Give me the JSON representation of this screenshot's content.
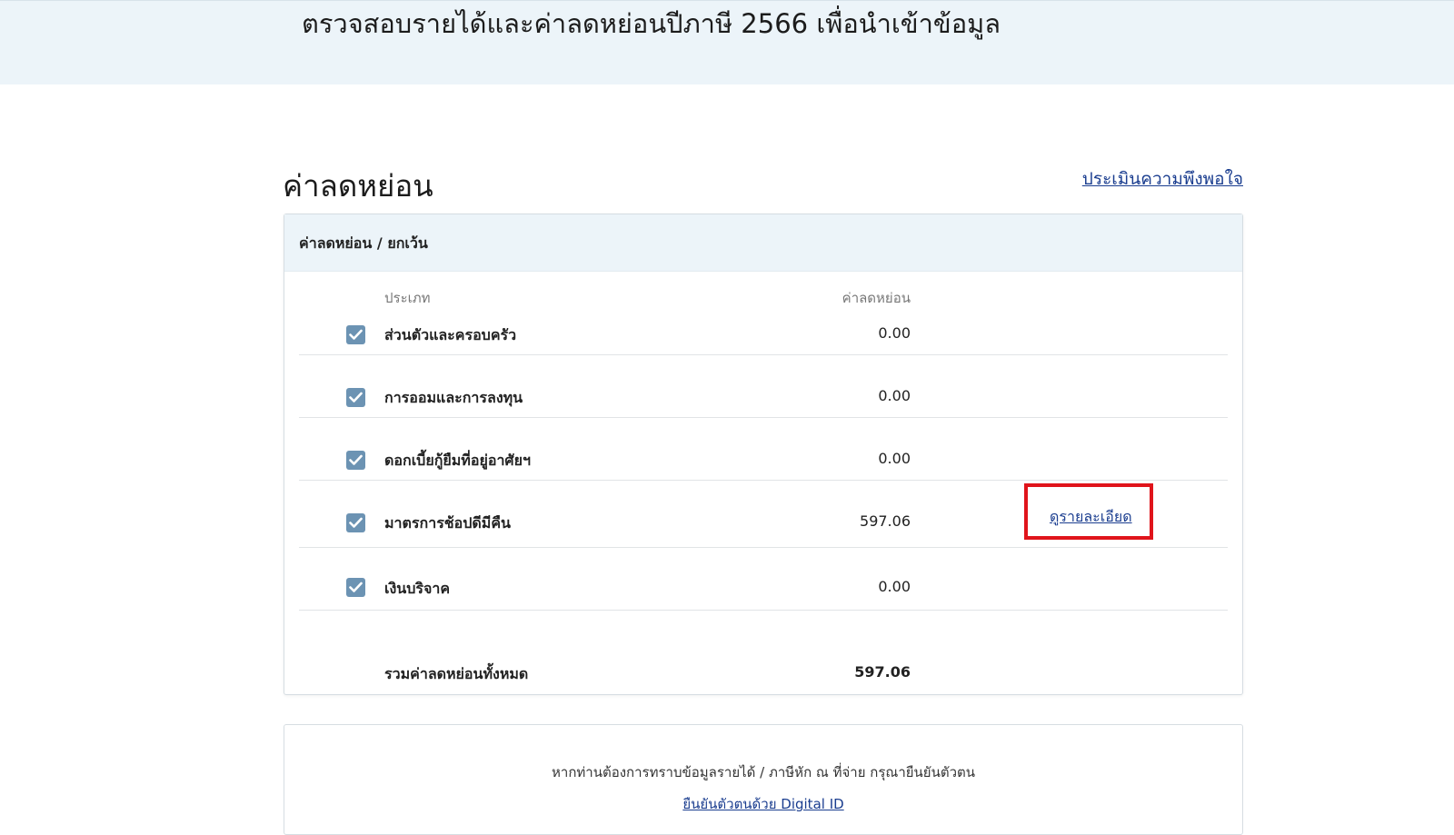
{
  "banner": {
    "title": "ตรวจสอบรายได้และค่าลดหย่อนปีภาษี 2566 เพื่อนำเข้าข้อมูล"
  },
  "section": {
    "title": "ค่าลดหย่อน",
    "satisfaction_link": "ประเมินความพึงพอใจ"
  },
  "card": {
    "header": "ค่าลดหย่อน / ยกเว้น",
    "columns": {
      "type": "ประเภท",
      "amount": "ค่าลดหย่อน"
    },
    "rows": [
      {
        "label": "ส่วนตัวและครอบครัว",
        "value": "0.00",
        "checked": true
      },
      {
        "label": "การออมและการลงทุน",
        "value": "0.00",
        "checked": true
      },
      {
        "label": "ดอกเบี้ยกู้ยืมที่อยู่อาศัยฯ",
        "value": "0.00",
        "checked": true
      },
      {
        "label": "มาตรการช้อปดีมีคืน",
        "value": "597.06",
        "checked": true,
        "detail_link": "ดูรายละเอียด"
      },
      {
        "label": "เงินบริจาค",
        "value": "0.00",
        "checked": true
      }
    ],
    "total": {
      "label": "รวมค่าลดหย่อนทั้งหมด",
      "value": "597.06"
    }
  },
  "info": {
    "text": "หากท่านต้องการทราบข้อมูลรายได้ / ภาษีหัก ณ ที่จ่าย กรุณายืนยันตัวตน",
    "link": "ยืนยันตัวตนด้วย Digital ID"
  },
  "colors": {
    "banner_bg": "#ecf4f9",
    "checkbox": "#6c93b3",
    "link": "#1a3d8f",
    "highlight": "#e0141b"
  }
}
